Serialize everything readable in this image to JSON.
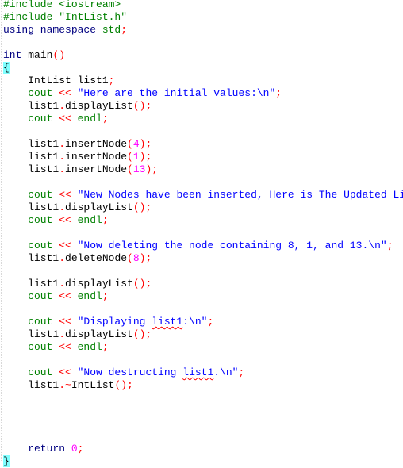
{
  "editor": {
    "lines": [
      {
        "tokens": [
          {
            "t": "#include <iostream>",
            "c": "pp"
          }
        ]
      },
      {
        "tokens": [
          {
            "t": "#include \"IntList.h\"",
            "c": "pp"
          }
        ]
      },
      {
        "tokens": [
          {
            "t": "using namespace ",
            "c": "kw"
          },
          {
            "t": "std",
            "c": "std"
          },
          {
            "t": ";",
            "c": "op"
          }
        ]
      },
      {
        "tokens": []
      },
      {
        "tokens": [
          {
            "t": "int ",
            "c": "kw"
          },
          {
            "t": "main",
            "c": "id"
          },
          {
            "t": "()",
            "c": "op"
          }
        ]
      },
      {
        "tokens": [
          {
            "t": "{",
            "c": "id brace-hl"
          }
        ]
      },
      {
        "tokens": [
          {
            "t": "    IntList list1",
            "c": "id"
          },
          {
            "t": ";",
            "c": "op"
          }
        ]
      },
      {
        "tokens": [
          {
            "t": "    cout ",
            "c": "std"
          },
          {
            "t": "<<",
            "c": "op"
          },
          {
            "t": " \"Here are the initial values:\\n\"",
            "c": "str"
          },
          {
            "t": ";",
            "c": "op"
          }
        ]
      },
      {
        "tokens": [
          {
            "t": "    list1",
            "c": "id"
          },
          {
            "t": ".",
            "c": "op"
          },
          {
            "t": "displayList",
            "c": "id"
          },
          {
            "t": "();",
            "c": "op"
          }
        ]
      },
      {
        "tokens": [
          {
            "t": "    cout ",
            "c": "std"
          },
          {
            "t": "<<",
            "c": "op"
          },
          {
            "t": " endl",
            "c": "std"
          },
          {
            "t": ";",
            "c": "op"
          }
        ]
      },
      {
        "tokens": []
      },
      {
        "tokens": [
          {
            "t": "    list1",
            "c": "id"
          },
          {
            "t": ".",
            "c": "op"
          },
          {
            "t": "insertNode",
            "c": "id"
          },
          {
            "t": "(",
            "c": "op"
          },
          {
            "t": "4",
            "c": "num"
          },
          {
            "t": ");",
            "c": "op"
          }
        ]
      },
      {
        "tokens": [
          {
            "t": "    list1",
            "c": "id"
          },
          {
            "t": ".",
            "c": "op"
          },
          {
            "t": "insertNode",
            "c": "id"
          },
          {
            "t": "(",
            "c": "op"
          },
          {
            "t": "1",
            "c": "num"
          },
          {
            "t": ");",
            "c": "op"
          }
        ]
      },
      {
        "tokens": [
          {
            "t": "    list1",
            "c": "id"
          },
          {
            "t": ".",
            "c": "op"
          },
          {
            "t": "insertNode",
            "c": "id"
          },
          {
            "t": "(",
            "c": "op"
          },
          {
            "t": "13",
            "c": "num"
          },
          {
            "t": ");",
            "c": "op"
          }
        ]
      },
      {
        "tokens": []
      },
      {
        "tokens": [
          {
            "t": "    cout ",
            "c": "std"
          },
          {
            "t": "<<",
            "c": "op"
          },
          {
            "t": " \"New Nodes have been inserted, Here is The Updated List:\\n\"",
            "c": "str"
          },
          {
            "t": ";",
            "c": "op"
          }
        ]
      },
      {
        "tokens": [
          {
            "t": "    list1",
            "c": "id"
          },
          {
            "t": ".",
            "c": "op"
          },
          {
            "t": "displayList",
            "c": "id"
          },
          {
            "t": "();",
            "c": "op"
          }
        ]
      },
      {
        "tokens": [
          {
            "t": "    cout ",
            "c": "std"
          },
          {
            "t": "<<",
            "c": "op"
          },
          {
            "t": " endl",
            "c": "std"
          },
          {
            "t": ";",
            "c": "op"
          }
        ]
      },
      {
        "tokens": []
      },
      {
        "tokens": [
          {
            "t": "    cout ",
            "c": "std"
          },
          {
            "t": "<<",
            "c": "op"
          },
          {
            "t": " \"Now deleting the node containing 8, 1, and 13.\\n\"",
            "c": "str"
          },
          {
            "t": ";",
            "c": "op"
          }
        ]
      },
      {
        "tokens": [
          {
            "t": "    list1",
            "c": "id"
          },
          {
            "t": ".",
            "c": "op"
          },
          {
            "t": "deleteNode",
            "c": "id"
          },
          {
            "t": "(",
            "c": "op"
          },
          {
            "t": "8",
            "c": "num"
          },
          {
            "t": ");",
            "c": "op"
          }
        ]
      },
      {
        "tokens": []
      },
      {
        "tokens": [
          {
            "t": "    list1",
            "c": "id"
          },
          {
            "t": ".",
            "c": "op"
          },
          {
            "t": "displayList",
            "c": "id"
          },
          {
            "t": "();",
            "c": "op"
          }
        ]
      },
      {
        "tokens": [
          {
            "t": "    cout ",
            "c": "std"
          },
          {
            "t": "<<",
            "c": "op"
          },
          {
            "t": " endl",
            "c": "std"
          },
          {
            "t": ";",
            "c": "op"
          }
        ]
      },
      {
        "tokens": []
      },
      {
        "tokens": [
          {
            "t": "    cout ",
            "c": "std"
          },
          {
            "t": "<<",
            "c": "op"
          },
          {
            "t": " \"Displaying ",
            "c": "str"
          },
          {
            "t": "list1",
            "c": "str squiggle"
          },
          {
            "t": ":\\n\"",
            "c": "str"
          },
          {
            "t": ";",
            "c": "op"
          }
        ]
      },
      {
        "tokens": [
          {
            "t": "    list1",
            "c": "id"
          },
          {
            "t": ".",
            "c": "op"
          },
          {
            "t": "displayList",
            "c": "id"
          },
          {
            "t": "();",
            "c": "op"
          }
        ]
      },
      {
        "tokens": [
          {
            "t": "    cout ",
            "c": "std"
          },
          {
            "t": "<<",
            "c": "op"
          },
          {
            "t": " endl",
            "c": "std"
          },
          {
            "t": ";",
            "c": "op"
          }
        ]
      },
      {
        "tokens": []
      },
      {
        "tokens": [
          {
            "t": "    cout ",
            "c": "std"
          },
          {
            "t": "<<",
            "c": "op"
          },
          {
            "t": " \"Now destructing ",
            "c": "str"
          },
          {
            "t": "list1",
            "c": "str squiggle"
          },
          {
            "t": ".\\n\"",
            "c": "str"
          },
          {
            "t": ";",
            "c": "op"
          }
        ]
      },
      {
        "tokens": [
          {
            "t": "    list1",
            "c": "id"
          },
          {
            "t": ".~",
            "c": "op"
          },
          {
            "t": "IntList",
            "c": "id"
          },
          {
            "t": "();",
            "c": "op"
          }
        ]
      },
      {
        "tokens": []
      },
      {
        "tokens": []
      },
      {
        "tokens": []
      },
      {
        "tokens": []
      },
      {
        "tokens": [
          {
            "t": "    return ",
            "c": "kw"
          },
          {
            "t": "0",
            "c": "num"
          },
          {
            "t": ";",
            "c": "op"
          }
        ]
      },
      {
        "tokens": [
          {
            "t": "}",
            "c": "id brace-hl"
          }
        ]
      }
    ]
  }
}
